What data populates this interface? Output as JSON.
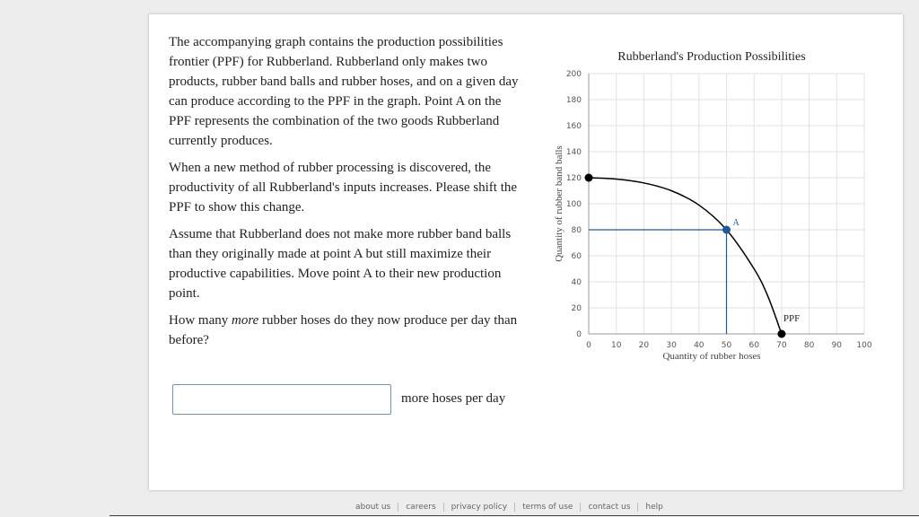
{
  "question": {
    "paragraphs": [
      "The accompanying graph contains the production possibilities frontier (PPF) for Rubberland. Rubberland only makes two products, rubber band balls and rubber hoses, and on a given day can produce according to the PPF in the graph. Point A on the PPF represents the combination of the two goods Rubberland currently produces.",
      "When a new method of rubber processing is discovered, the productivity of all Rubberland's inputs increases. Please shift the PPF to show this change.",
      "Assume that Rubberland does not make more rubber band balls than they originally made at point A but still maximize their productive capabilities. Move point A to their new production point."
    ],
    "final_prefix": "How many ",
    "final_emphasis": "more",
    "final_suffix": " rubber hoses do they now produce per day than before?",
    "answer_value": "",
    "answer_unit": "more hoses per day"
  },
  "chart_data": {
    "type": "line",
    "title": "Rubberland's Production Possibilities",
    "xlabel": "Quantity of rubber hoses",
    "ylabel": "Quantity of rubber band balls",
    "xlim": [
      0,
      100
    ],
    "ylim": [
      0,
      200
    ],
    "xticks": [
      0,
      10,
      20,
      30,
      40,
      50,
      60,
      70,
      80,
      90,
      100
    ],
    "yticks": [
      0,
      20,
      40,
      60,
      80,
      100,
      120,
      140,
      160,
      180,
      200
    ],
    "grid": true,
    "series": [
      {
        "name": "PPF",
        "color": "#000000",
        "points": [
          [
            0,
            120
          ],
          [
            10,
            119
          ],
          [
            20,
            116
          ],
          [
            30,
            110
          ],
          [
            40,
            99
          ],
          [
            50,
            80
          ],
          [
            60,
            50
          ],
          [
            65,
            29
          ],
          [
            70,
            0
          ]
        ]
      }
    ],
    "endpoints": [
      [
        0,
        120
      ],
      [
        70,
        0
      ]
    ],
    "point_a": {
      "label": "A",
      "x": 50,
      "y": 80,
      "color": "#1f5a96"
    },
    "guide_color": "#1f5a96"
  },
  "footer": {
    "links": [
      "about us",
      "careers",
      "privacy policy",
      "terms of use",
      "contact us",
      "help"
    ]
  }
}
